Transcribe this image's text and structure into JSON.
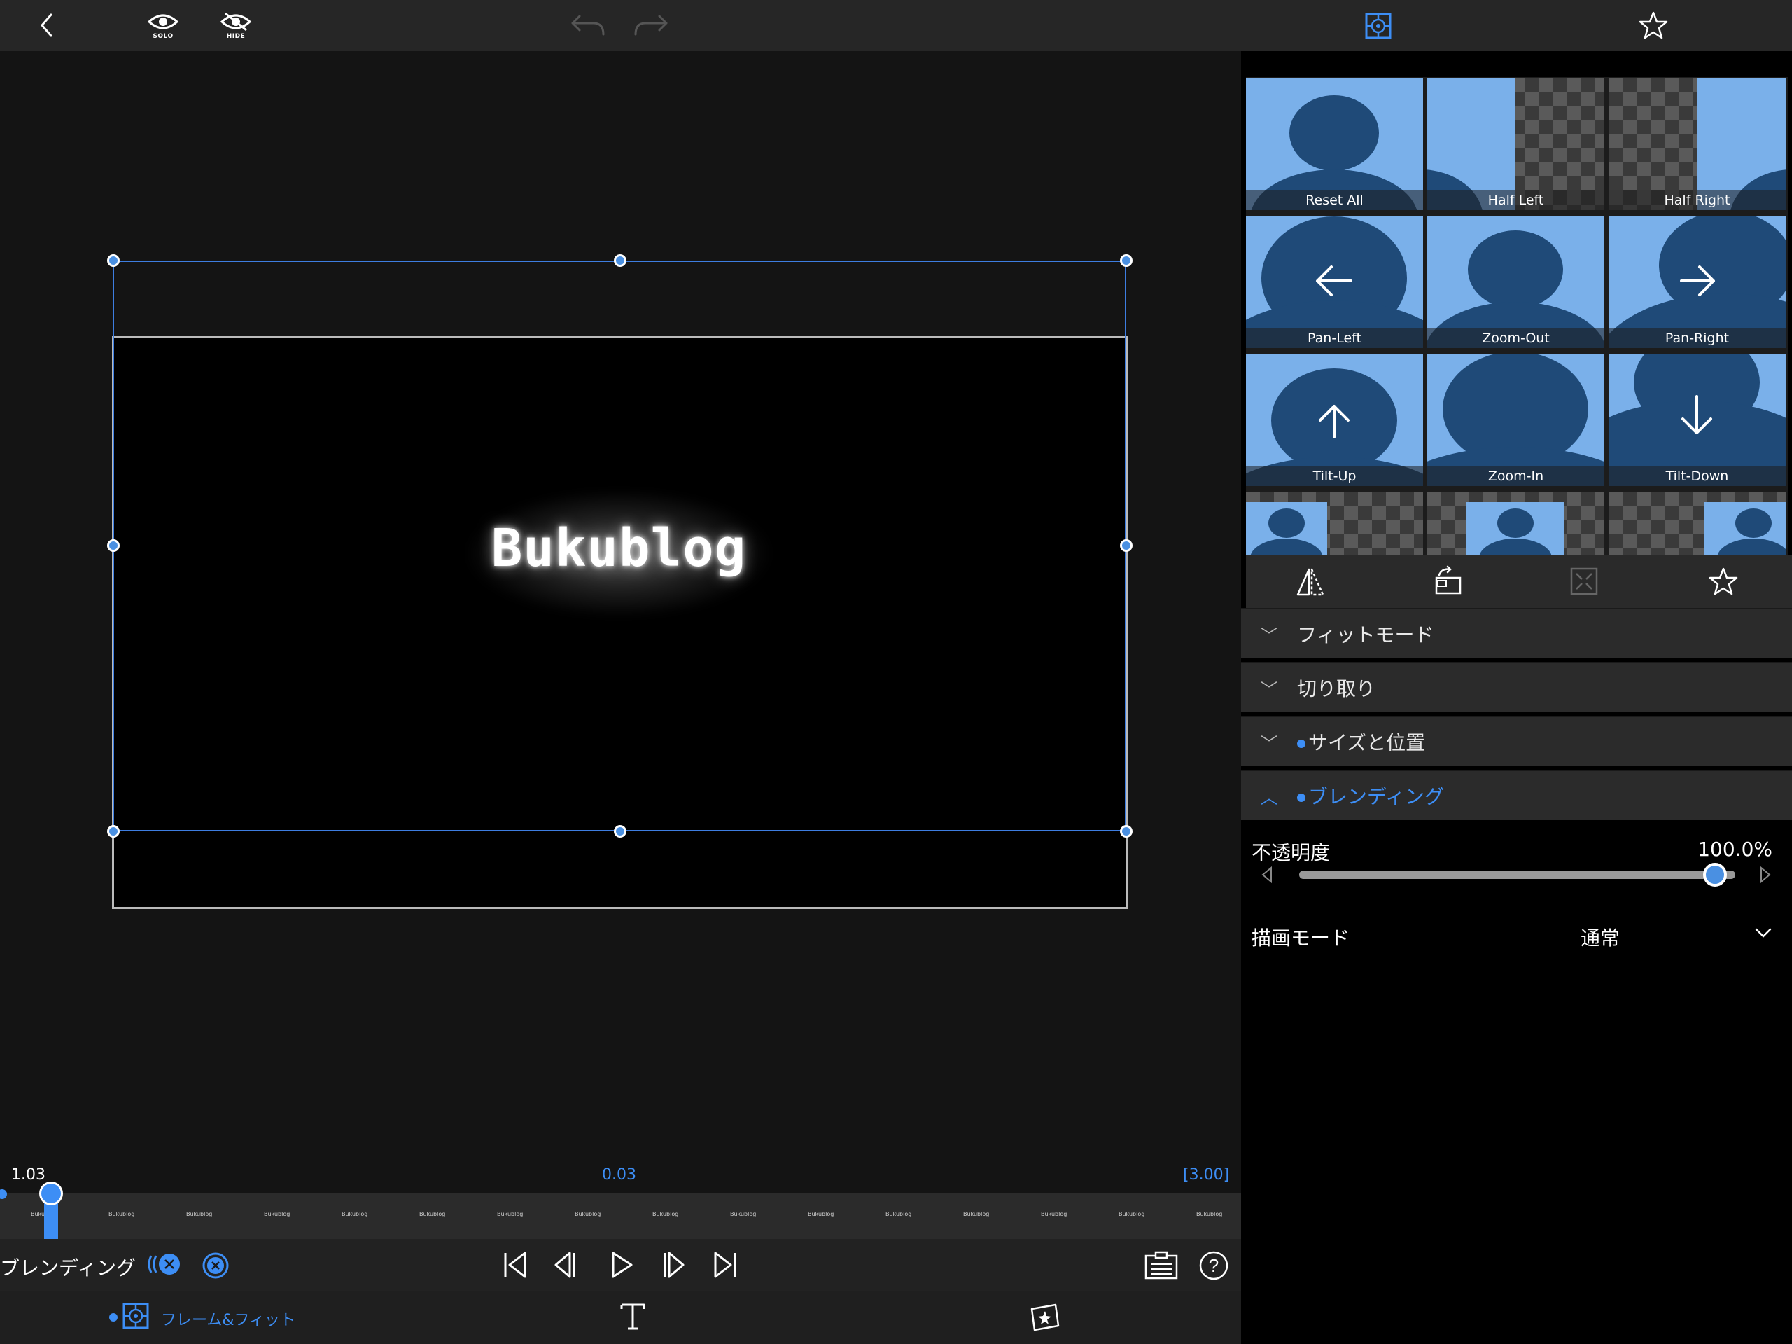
{
  "topbar": {
    "solo_label": "SOLO",
    "hide_label": "HIDE"
  },
  "preview": {
    "title_text": "Bukublog"
  },
  "timeline": {
    "current_time": "1.03",
    "center_time": "0.03",
    "duration": "[3.00]",
    "frame_labels": [
      "Bukublog",
      "Bukublog",
      "Bukublog",
      "Bukublog",
      "Bukublog",
      "Bukublog",
      "Bukublog",
      "Bukublog",
      "Bukublog",
      "Bukublog",
      "Bukublog",
      "Bukublog",
      "Bukublog",
      "Bukublog",
      "Bukublog",
      "Bukublog"
    ]
  },
  "transport": {
    "section_label": "ブレンディング"
  },
  "bottombar": {
    "frame_fit_label": "フレーム&フィット"
  },
  "presets": [
    {
      "label": "Reset All"
    },
    {
      "label": "Half Left"
    },
    {
      "label": "Half Right"
    },
    {
      "label": "Pan-Left"
    },
    {
      "label": "Zoom-Out"
    },
    {
      "label": "Pan-Right"
    },
    {
      "label": "Tilt-Up"
    },
    {
      "label": "Zoom-In"
    },
    {
      "label": "Tilt-Down"
    }
  ],
  "sections": {
    "fit_mode": "フィットモード",
    "crop": "切り取り",
    "size_position": "サイズと位置",
    "blending": "ブレンディング"
  },
  "blending": {
    "opacity_label": "不透明度",
    "opacity_value": "100.0%",
    "opacity_fraction": 1.0,
    "draw_mode_label": "描画モード",
    "draw_mode_value": "通常"
  },
  "colors": {
    "accent": "#3d8ef5",
    "tile_bg": "#7ab0ea",
    "silhouette": "#1f4a78"
  }
}
